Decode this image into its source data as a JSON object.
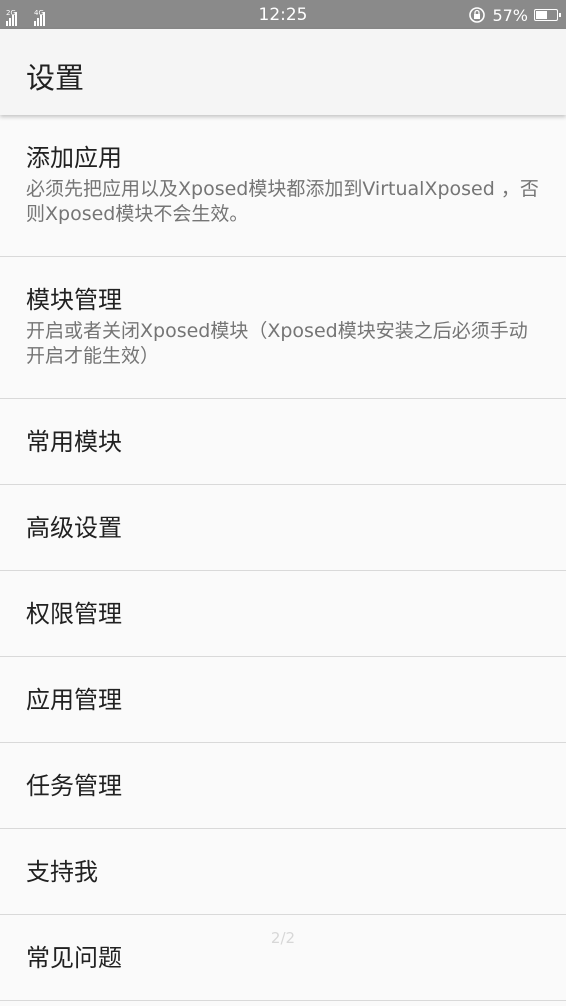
{
  "status_bar": {
    "sim1_label": "2G",
    "sim2_label": "4G",
    "sim2_extra": "⁴",
    "time": "12:25",
    "battery_text": "57%",
    "battery_level": 0.57,
    "icons": [
      "signal-icon",
      "rotation-lock-icon",
      "battery-icon"
    ]
  },
  "toolbar": {
    "title": "设置"
  },
  "settings": {
    "items": [
      {
        "title": "添加应用",
        "summary": "必须先把应用以及Xposed模块都添加到VirtualXposed ，否则Xposed模块不会生效。"
      },
      {
        "title": "模块管理",
        "summary": "开启或者关闭Xposed模块（Xposed模块安装之后必须手动开启才能生效）"
      },
      {
        "title": "常用模块"
      },
      {
        "title": "高级设置"
      },
      {
        "title": "权限管理"
      },
      {
        "title": "应用管理"
      },
      {
        "title": "任务管理"
      },
      {
        "title": "支持我"
      },
      {
        "title": "常见问题"
      }
    ]
  },
  "page_indicator": "2/2",
  "colors": {
    "status_bar": "#8a8a8a",
    "toolbar": "#f5f5f5",
    "background": "#fafafa",
    "primary_text": "#212121",
    "secondary_text": "#757575",
    "divider": "#d9d9d9"
  }
}
